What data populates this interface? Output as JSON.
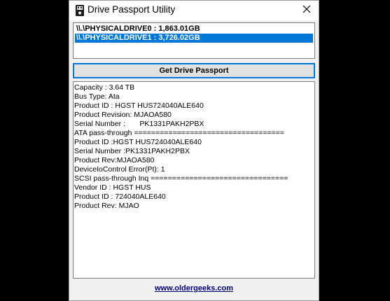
{
  "window": {
    "title": "Drive Passport Utility",
    "icon": "usb-drive-icon",
    "close_icon": "close-icon"
  },
  "drives": [
    {
      "label": "\\\\.\\PHYSICALDRIVE0 : 1,863.01GB",
      "selected": false
    },
    {
      "label": "\\\\.\\PHYSICALDRIVE1 : 3,726.02GB",
      "selected": true
    }
  ],
  "action": {
    "label": "Get Drive Passport"
  },
  "output": {
    "lines": [
      "Capacity : 3.64 TB",
      "Bus Type: Ata",
      "Product ID : HGST HUS724040ALE640",
      "Product Revision: MJAOA580",
      "Serial Number :       PK1331PAKH2PBX",
      "ATA pass-through ===================================",
      "Product ID :HGST HUS724040ALE640",
      "Serial Number :PK1331PAKH2PBX",
      "Product Rev:MJAOA580",
      "DeviceIoControl Error(Pt): 1",
      "SCSI pass-through Inq ================================",
      "Vendor ID : HGST HUS",
      "Product ID : 724040ALE640",
      "Product Rev: MJAO"
    ]
  },
  "footer": {
    "link": "www.oldergeeks.com"
  },
  "colors": {
    "selection": "#0078d7",
    "link": "#000080",
    "background": "#f0f0f0"
  }
}
